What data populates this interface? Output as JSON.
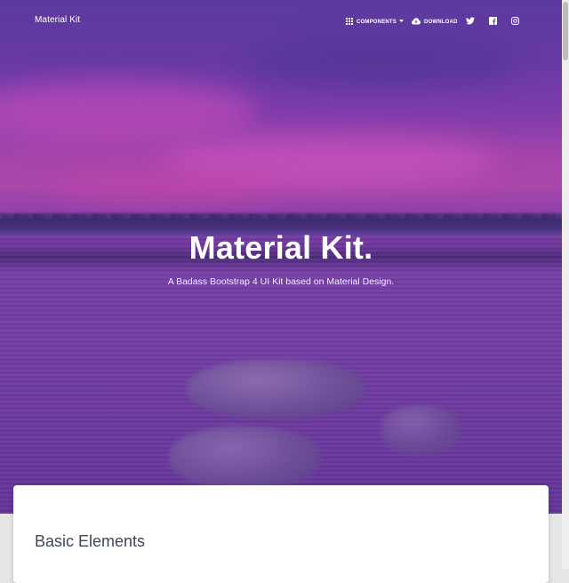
{
  "navbar": {
    "brand": "Material Kit",
    "components_label": "COMPONENTS",
    "download_label": "DOWNLOAD",
    "icons": {
      "components": "apps-grid-icon",
      "components_caret": "caret-down-icon",
      "download": "cloud-download-icon",
      "twitter": "twitter-icon",
      "facebook": "facebook-icon",
      "instagram": "instagram-icon"
    }
  },
  "hero": {
    "title": "Material Kit.",
    "subtitle": "A Badass Bootstrap 4 UI Kit based on Material Design."
  },
  "section": {
    "title": "Basic Elements"
  },
  "colors": {
    "hero_tint": "#6b3f9f",
    "title_text": "#3c4858"
  }
}
